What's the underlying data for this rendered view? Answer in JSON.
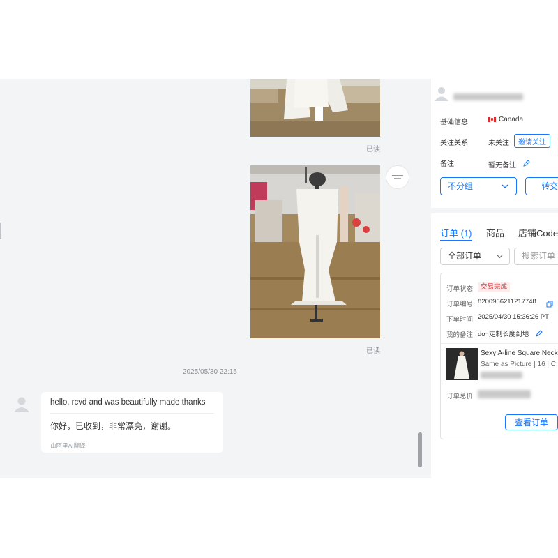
{
  "chat": {
    "read_label_1": "已读",
    "read_label_2": "已读",
    "timestamp": "2025/05/30 22:15",
    "message": {
      "original_text": "hello, rcvd and was beautifully made thanks",
      "translated_text": "你好，已收到，非常漂亮，谢谢。",
      "translation_note": "由阿里AI翻译"
    }
  },
  "customer": {
    "basic_info_label": "基础信息",
    "country": "Canada",
    "follow_label": "关注关系",
    "follow_status": "未关注",
    "invite_button": "邀请关注",
    "remark_label": "备注",
    "remark_value": "暂无备注",
    "group_select": "不分组",
    "transfer_button": "转交"
  },
  "tabs": [
    {
      "label": "订单 (1)",
      "active": true
    },
    {
      "label": "商品",
      "active": false
    },
    {
      "label": "店铺Code",
      "active": false
    }
  ],
  "orders": {
    "filter_value": "全部订单",
    "search_placeholder": "搜索订单",
    "card": {
      "status_label": "订单状态",
      "status_value": "交易完成",
      "number_label": "订单编号",
      "number_value": "8200966211217748",
      "time_label": "下单时间",
      "time_value": "2025/04/30 15:36:26 PT",
      "remark_label": "我的备注",
      "remark_value": "do=定制长度到地",
      "product_title": "Sexy A-line Square Neck",
      "product_spec": "Same as Picture | 16 | C",
      "total_label": "订单总价",
      "view_button": "查看订单"
    }
  },
  "colors": {
    "accent": "#1677ff",
    "chat_background": "#f3f4f6",
    "status_red": "#e0393e"
  },
  "icons": [
    "user-avatar-icon",
    "canada-flag-icon",
    "edit-icon",
    "chevron-down-icon",
    "copy-icon",
    "transfer-icon"
  ]
}
